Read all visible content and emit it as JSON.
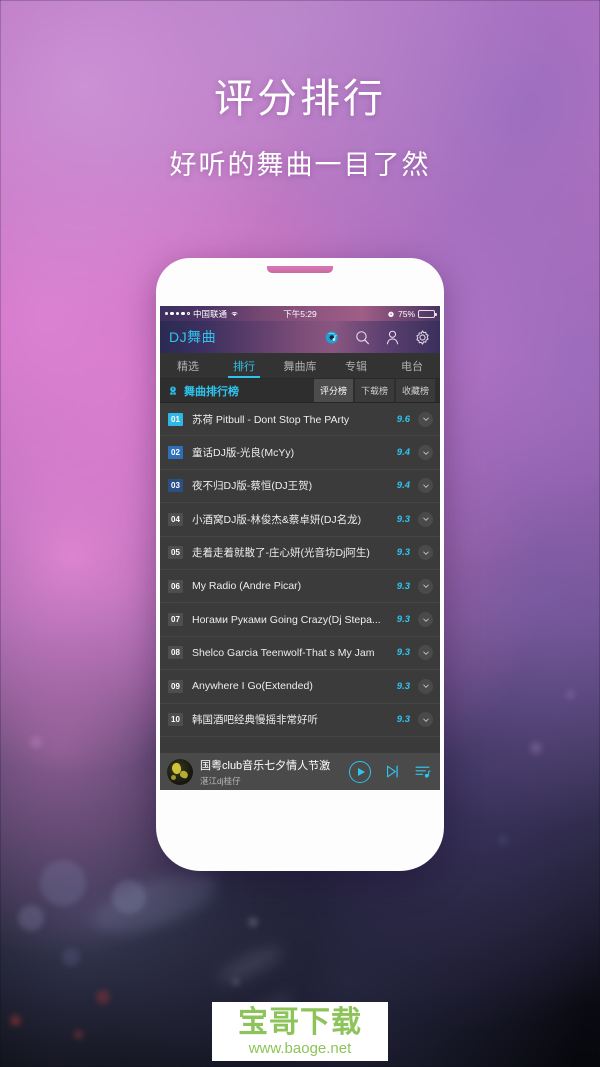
{
  "promo": {
    "title": "评分排行",
    "subtitle": "好听的舞曲一目了然"
  },
  "colors": {
    "accent_cyan": "#2fc4ee",
    "rank1": "#2fb8e6",
    "rank2": "#2d6fb8",
    "rank3": "#2a4f86",
    "watermark_green": "#8dc45a",
    "list_bg": "#3b3b3b",
    "player_bg": "#4a4a4a"
  },
  "status_bar": {
    "carrier": "中国联通",
    "wifi_icon": "wifi-icon",
    "time": "下午5:29",
    "alarm_icon": "alarm-icon",
    "battery_percent": "75%",
    "battery_level": 75
  },
  "app_bar": {
    "title": "DJ舞曲",
    "icons": [
      {
        "name": "disc-music-icon",
        "label": "音乐圆盘"
      },
      {
        "name": "search-icon",
        "label": "搜索"
      },
      {
        "name": "user-icon",
        "label": "我的"
      },
      {
        "name": "gear-icon",
        "label": "设置"
      }
    ]
  },
  "nav_tabs": {
    "active_index": 1,
    "items": [
      {
        "label": "精选"
      },
      {
        "label": "排行"
      },
      {
        "label": "舞曲库"
      },
      {
        "label": "专辑"
      },
      {
        "label": "电台"
      }
    ]
  },
  "section": {
    "icon": "ranking-badge-icon",
    "title": "舞曲排行榜",
    "segments": [
      {
        "label": "评分榜",
        "active": true
      },
      {
        "label": "下载榜",
        "active": false
      },
      {
        "label": "收藏榜",
        "active": false
      }
    ]
  },
  "songs": [
    {
      "rank": "01",
      "title": "苏荷 Pitbull - Dont Stop The PArty",
      "score": "9.6"
    },
    {
      "rank": "02",
      "title": "童话DJ版-光良(McYy)",
      "score": "9.4"
    },
    {
      "rank": "03",
      "title": "夜不归DJ版-蔡恒(DJ王贺)",
      "score": "9.4"
    },
    {
      "rank": "04",
      "title": "小酒窝DJ版-林俊杰&蔡卓妍(DJ名龙)",
      "score": "9.3"
    },
    {
      "rank": "05",
      "title": "走着走着就散了-庄心妍(光音坊Dj阿生)",
      "score": "9.3"
    },
    {
      "rank": "06",
      "title": "My Radio (Andre Picar)",
      "score": "9.3"
    },
    {
      "rank": "07",
      "title": "Ногами Руками Going Crazy(Dj Stepa...",
      "score": "9.3"
    },
    {
      "rank": "08",
      "title": "Shelco Garcia Teenwolf-That s My Jam",
      "score": "9.3"
    },
    {
      "rank": "09",
      "title": "Anywhere I Go(Extended)",
      "score": "9.3"
    },
    {
      "rank": "10",
      "title": "韩国酒吧经典慢摇非常好听",
      "score": "9.3"
    }
  ],
  "player": {
    "song": "国粤club音乐七夕情人节激",
    "artist": "湛江dj桂仔",
    "play_icon": "play-icon",
    "next_icon": "next-track-icon",
    "playlist_icon": "playlist-icon"
  },
  "watermark": {
    "title": "宝哥下载",
    "url": "www.baoge.net"
  }
}
